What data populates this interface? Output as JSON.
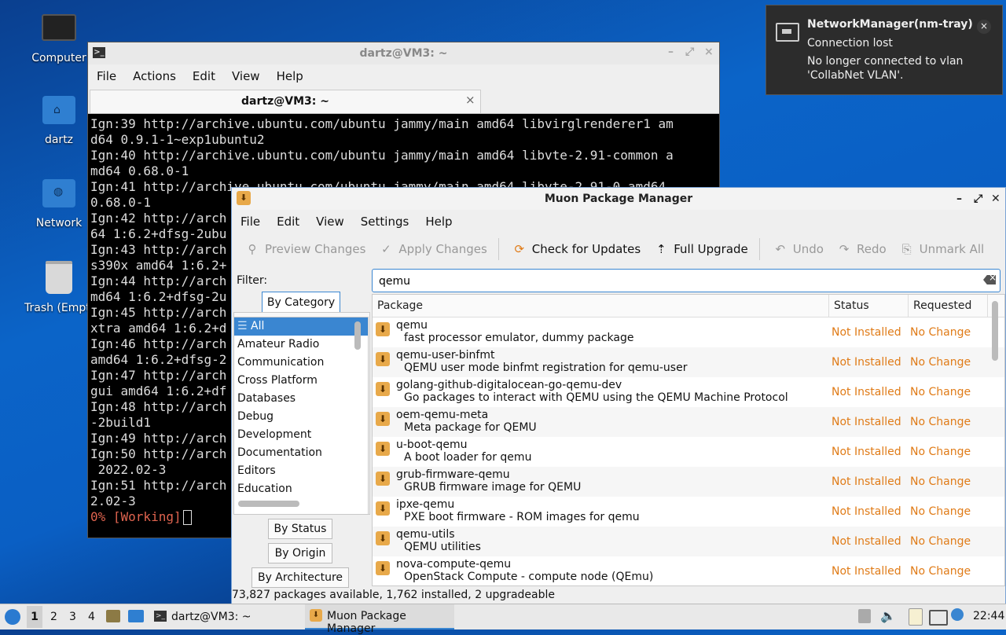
{
  "desktop": {
    "icons": [
      {
        "label": "Computer"
      },
      {
        "label": "dartz"
      },
      {
        "label": "Network"
      },
      {
        "label": "Trash (Empty)"
      }
    ]
  },
  "terminal": {
    "title": "dartz@VM3: ~",
    "menu": [
      "File",
      "Actions",
      "Edit",
      "View",
      "Help"
    ],
    "tab_title": "dartz@VM3: ~",
    "lines": [
      "Ign:39 http://archive.ubuntu.com/ubuntu jammy/main amd64 libvirglrenderer1 am",
      "d64 0.9.1-1~exp1ubuntu2",
      "Ign:40 http://archive.ubuntu.com/ubuntu jammy/main amd64 libvte-2.91-common a",
      "md64 0.68.0-1",
      "Ign:41 http://archive.ubuntu.com/ubuntu jammy/main amd64 libvte-2.91-0 amd64",
      "0.68.0-1",
      "Ign:42 http://arch",
      "64 1:6.2+dfsg-2ubu",
      "Ign:43 http://arch",
      "s390x amd64 1:6.2+",
      "Ign:44 http://arch",
      "md64 1:6.2+dfsg-2u",
      "Ign:45 http://arch",
      "xtra amd64 1:6.2+d",
      "Ign:46 http://arch",
      "amd64 1:6.2+dfsg-2",
      "Ign:47 http://arch",
      "gui amd64 1:6.2+df",
      "Ign:48 http://arch",
      "-2build1",
      "Ign:49 http://arch",
      "Ign:50 http://arch",
      " 2022.02-3",
      "Ign:51 http://arch",
      "2.02-3"
    ],
    "working": "0% [Working]"
  },
  "muon": {
    "title": "Muon Package Manager",
    "menu": [
      "File",
      "Edit",
      "View",
      "Settings",
      "Help"
    ],
    "toolbar": {
      "preview": "Preview Changes",
      "apply": "Apply Changes",
      "check": "Check for Updates",
      "upgrade": "Full Upgrade",
      "undo": "Undo",
      "redo": "Redo",
      "unmark": "Unmark All"
    },
    "filter_label": "Filter:",
    "filter_value": "qemu",
    "tabs": {
      "category": "By Category",
      "status": "By Status",
      "origin": "By Origin",
      "arch": "By Architecture"
    },
    "categories": [
      "All",
      "Amateur Radio",
      "Communication",
      "Cross Platform",
      "Databases",
      "Debug",
      "Development",
      "Documentation",
      "Editors",
      "Education"
    ],
    "columns": {
      "package": "Package",
      "status": "Status",
      "requested": "Requested"
    },
    "packages": [
      {
        "name": "qemu",
        "desc": "fast processor emulator, dummy package",
        "status": "Not Installed",
        "requested": "No Change"
      },
      {
        "name": "qemu-user-binfmt",
        "desc": "QEMU user mode binfmt registration for qemu-user",
        "status": "Not Installed",
        "requested": "No Change"
      },
      {
        "name": "golang-github-digitalocean-go-qemu-dev",
        "desc": "Go packages to interact with QEMU using the QEMU Machine Protocol",
        "status": "Not Installed",
        "requested": "No Change"
      },
      {
        "name": "oem-qemu-meta",
        "desc": "Meta package for QEMU",
        "status": "Not Installed",
        "requested": "No Change"
      },
      {
        "name": "u-boot-qemu",
        "desc": "A boot loader for qemu",
        "status": "Not Installed",
        "requested": "No Change"
      },
      {
        "name": "grub-firmware-qemu",
        "desc": "GRUB firmware image for QEMU",
        "status": "Not Installed",
        "requested": "No Change"
      },
      {
        "name": "ipxe-qemu",
        "desc": "PXE boot firmware - ROM images for qemu",
        "status": "Not Installed",
        "requested": "No Change"
      },
      {
        "name": "qemu-utils",
        "desc": "QEMU utilities",
        "status": "Not Installed",
        "requested": "No Change"
      },
      {
        "name": "nova-compute-qemu",
        "desc": "OpenStack Compute - compute node (QEmu)",
        "status": "Not Installed",
        "requested": "No Change"
      }
    ],
    "statusbar": "73,827 packages available, 1,762 installed, 2 upgradeable"
  },
  "notification": {
    "app": "NetworkManager(nm-tray)",
    "title": "Connection lost",
    "body": "No longer connected to vlan 'CollabNet VLAN'."
  },
  "taskbar": {
    "workspaces": [
      "1",
      "2",
      "3",
      "4"
    ],
    "tasks": [
      {
        "label": "dartz@VM3: ~"
      },
      {
        "label": "Muon Package Manager"
      }
    ],
    "clock": "22:44"
  }
}
